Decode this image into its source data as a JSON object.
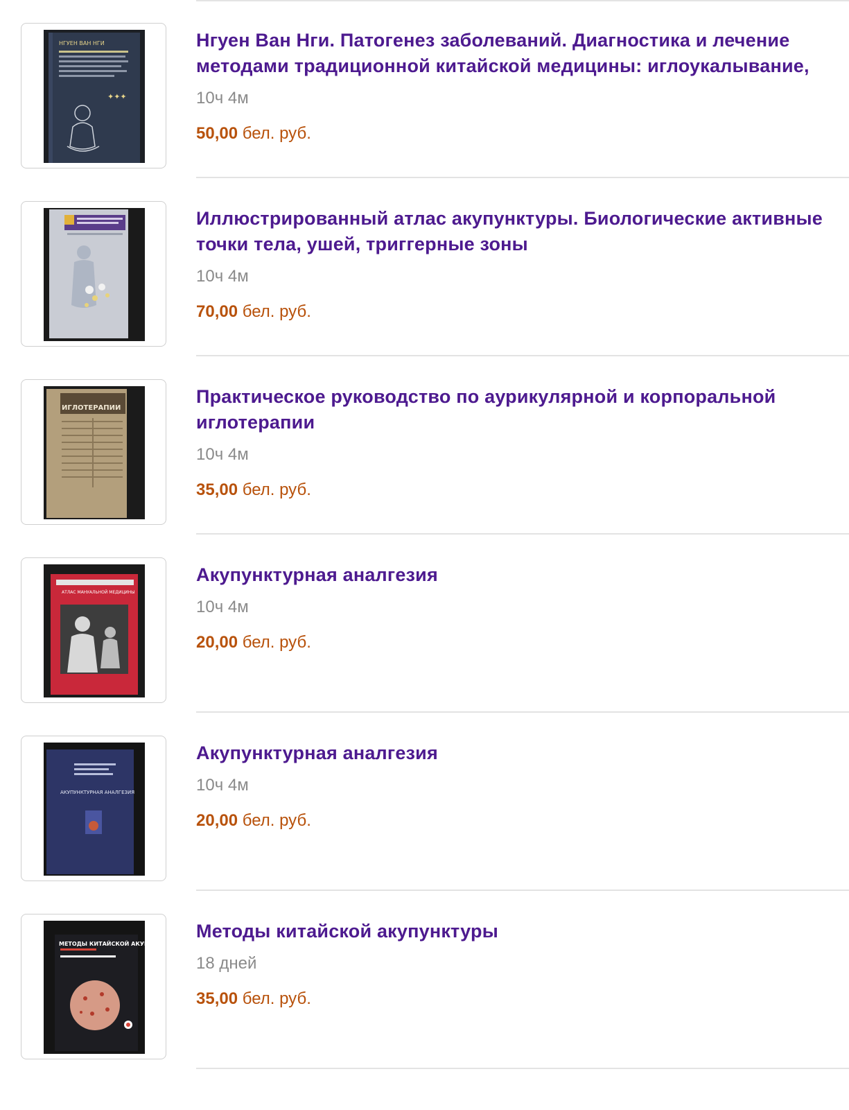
{
  "listings": [
    {
      "title": "Нгуен Ван Нги. Патогенез заболеваний. Диагностика и лечение методами традиционной китайской медицины: иглоукалывание,",
      "time_left": "10ч 4м",
      "price_amount": "50,00",
      "price_currency": "бел. руб.",
      "cover": {
        "color": "#2f3a4e",
        "text": "НГУЕН ВАН НГИ"
      }
    },
    {
      "title": "Иллюстрированный атлас акупунктуры. Биологические активные точки тела, ушей, триггерные зоны",
      "time_left": "10ч 4м",
      "price_amount": "70,00",
      "price_currency": "бел. руб.",
      "cover": {
        "color": "#c9ccd4"
      }
    },
    {
      "title": "Практическое руководство по аурикулярной и корпоральной иглотерапии",
      "time_left": "10ч 4м",
      "price_amount": "35,00",
      "price_currency": "бел. руб.",
      "cover": {
        "color": "#b39f7c",
        "text": "ИГЛОТЕРАПИИ"
      }
    },
    {
      "title": "Акупунктурная аналгезия",
      "time_left": "10ч 4м",
      "price_amount": "20,00",
      "price_currency": "бел. руб.",
      "cover": {
        "color": "#c9283a",
        "text": "АТЛАС МАНУАЛЬНОЙ МЕДИЦИНЫ"
      }
    },
    {
      "title": "Акупунктурная аналгезия",
      "time_left": "10ч 4м",
      "price_amount": "20,00",
      "price_currency": "бел. руб.",
      "cover": {
        "color": "#2d3566",
        "text": "АКУПУНКТУРНАЯ АНАЛГЕЗИЯ"
      }
    },
    {
      "title": "Методы китайской акупунктуры",
      "time_left": "18 дней",
      "price_amount": "35,00",
      "price_currency": "бел. руб.",
      "cover": {
        "color": "#141414",
        "text": "МЕТОДЫ КИТАЙСКОЙ АКУПУНКТУРЫ"
      }
    }
  ]
}
